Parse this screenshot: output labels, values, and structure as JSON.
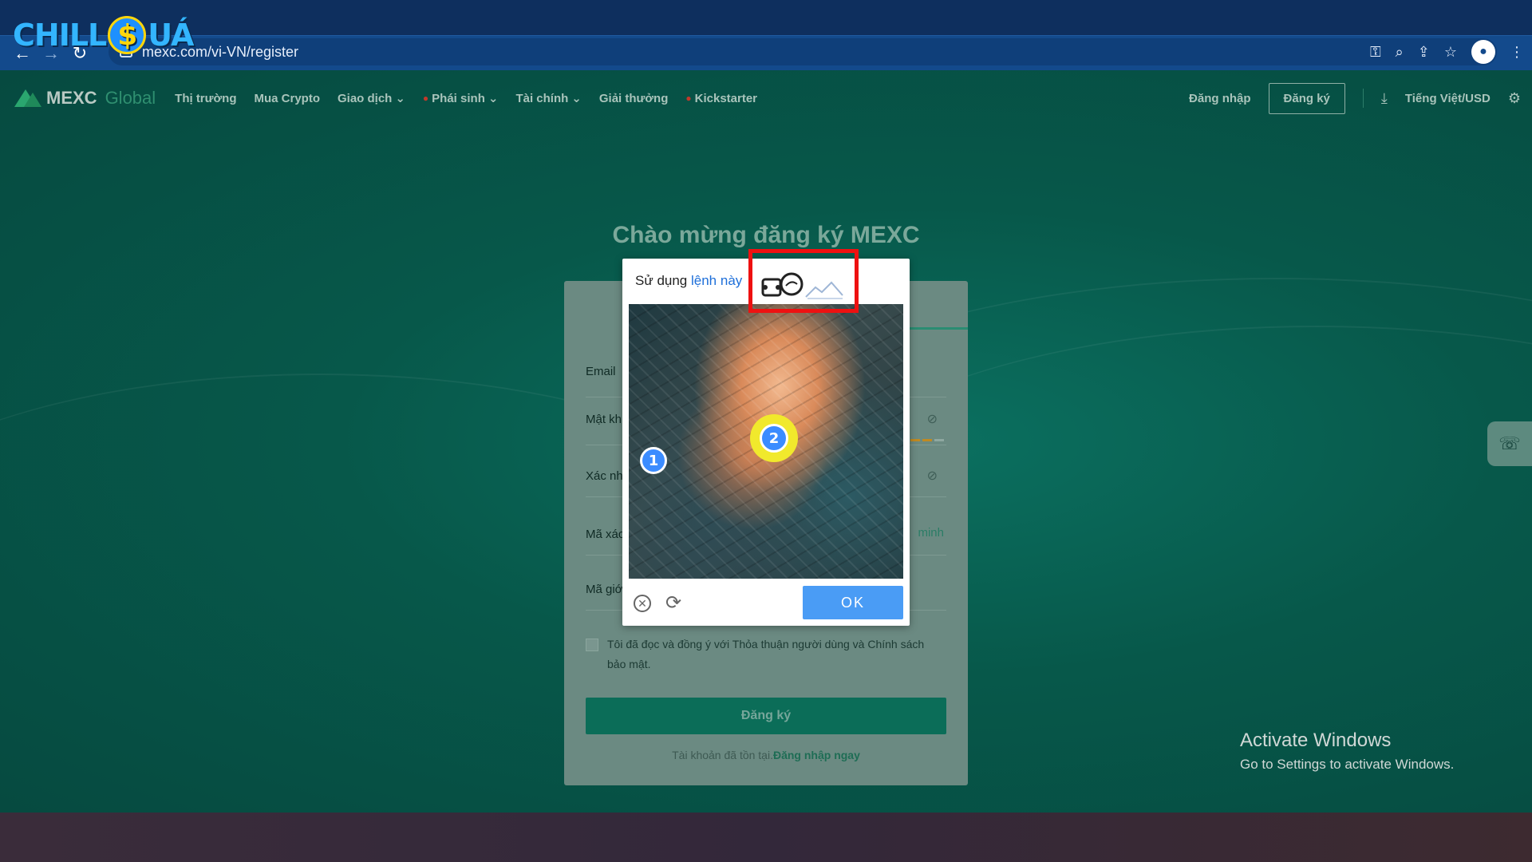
{
  "browser": {
    "url": "mexc.com/vi-VN/register",
    "watermark": {
      "left": "CHILL",
      "coin": "$",
      "right": "UÁ"
    }
  },
  "site": {
    "brand": "MEXC",
    "brand_sub": "Global",
    "nav": [
      "Thị trường",
      "Mua Crypto",
      "Giao dịch",
      "Phái sinh",
      "Tài chính",
      "Giải thưởng",
      "Kickstarter"
    ],
    "login": "Đăng nhập",
    "register": "Đăng ký",
    "language": "Tiếng Việt/USD"
  },
  "register": {
    "welcome": "Chào mừng đăng ký MEXC",
    "email_label": "Email",
    "password_label": "Mật kh",
    "confirm_label": "Xác nh",
    "code_label": "Mã xác",
    "referral_label": "Mã giớ",
    "side_link": "minh",
    "terms": "Tôi đã đọc và đồng ý với Thỏa thuận người dùng và Chính sách bảo mật.",
    "submit": "Đăng ký",
    "have_account": "Tài khoản đã tồn tại.",
    "login_now": "Đăng nhập ngay"
  },
  "captcha": {
    "prefix": "Sử dụng",
    "link": "lệnh này",
    "marker1": "1",
    "marker2": "2",
    "ok": "OK"
  },
  "os": {
    "activate_title": "Activate Windows",
    "activate_sub": "Go to Settings to activate Windows."
  },
  "colors": {
    "accent": "#0b6d58",
    "captcha_ok": "#4a9cf5",
    "highlight": "#ee1111"
  }
}
